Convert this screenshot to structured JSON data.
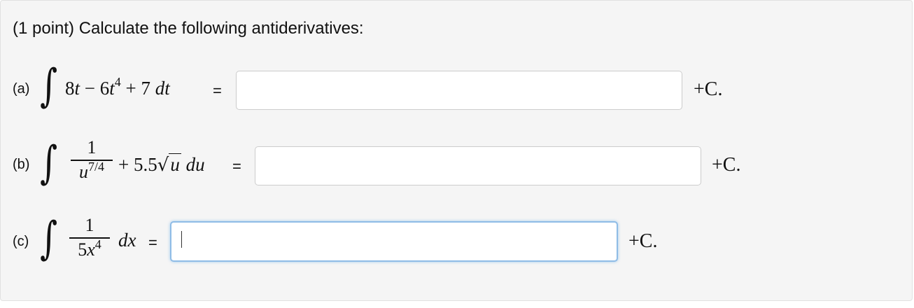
{
  "prompt": "(1 point) Calculate the following antiderivatives:",
  "integral_symbol": "∫",
  "plus_c": "+C.",
  "equals": "=",
  "part_a": {
    "label": "(a)",
    "term1": "8",
    "var1": "t",
    "minus": " − 6",
    "var2": "t",
    "exp": "4",
    "const": " + 7 ",
    "diff": "dt",
    "answer_value": ""
  },
  "part_b": {
    "label": "(b)",
    "numerator": "1",
    "den_var": "u",
    "den_exp": "7/4",
    "plus": "+ 5.5",
    "radicand": "u",
    "diff": " du",
    "answer_value": ""
  },
  "part_c": {
    "label": "(c)",
    "numerator": "1",
    "den_coef": "5",
    "den_var": "x",
    "den_exp": "4",
    "diff": "dx",
    "answer_value": ""
  }
}
